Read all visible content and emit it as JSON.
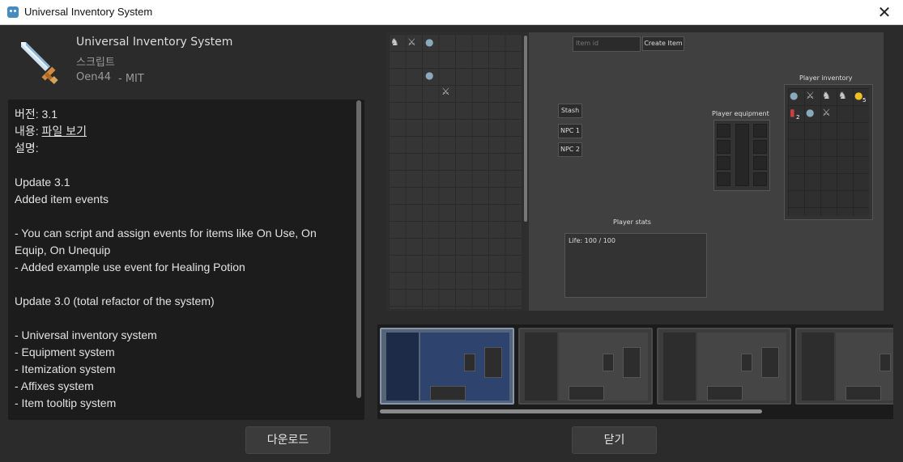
{
  "window": {
    "title": "Universal Inventory System",
    "close_glyph": "✕"
  },
  "asset": {
    "name": "Universal Inventory System",
    "category": "스크립트",
    "author": "Oen44",
    "license": "- MIT",
    "icon": "sword-icon"
  },
  "description": {
    "lines": [
      {
        "label": "버전:",
        "value": "3.1"
      },
      {
        "label": "내용:",
        "value": "파일 보기"
      },
      {
        "label": "설명:",
        "value": ""
      }
    ],
    "body": [
      "",
      "Update 3.1",
      "Added item events",
      "",
      "- You can script and assign events for items like On Use, On",
      "Equip, On Unequip",
      "- Added example use event for Healing Potion",
      "",
      "Update 3.0 (total refactor of the system)",
      "",
      "- Universal inventory system",
      "- Equipment system",
      "- Itemization system",
      "- Affixes system",
      "- Item tooltip system"
    ]
  },
  "buttons": {
    "download": "다운로드",
    "close": "닫기"
  },
  "preview": {
    "item_id_placeholder": "Item id",
    "create_item": "Create Item",
    "stash": "Stash",
    "npc1": "NPC 1",
    "npc2": "NPC 2",
    "player_equipment": "Player equipment",
    "player_inventory": "Player inventory",
    "player_stats": "Player stats",
    "life": "Life:  100 / 100",
    "stack_2": "2",
    "stack_5": "5"
  },
  "colors": {
    "window_bg": "#2b2b2b",
    "panel_bg": "#1c1c1c",
    "text": "#e2e2e2",
    "muted": "#9a9a9a",
    "accent": "#478cbf"
  }
}
